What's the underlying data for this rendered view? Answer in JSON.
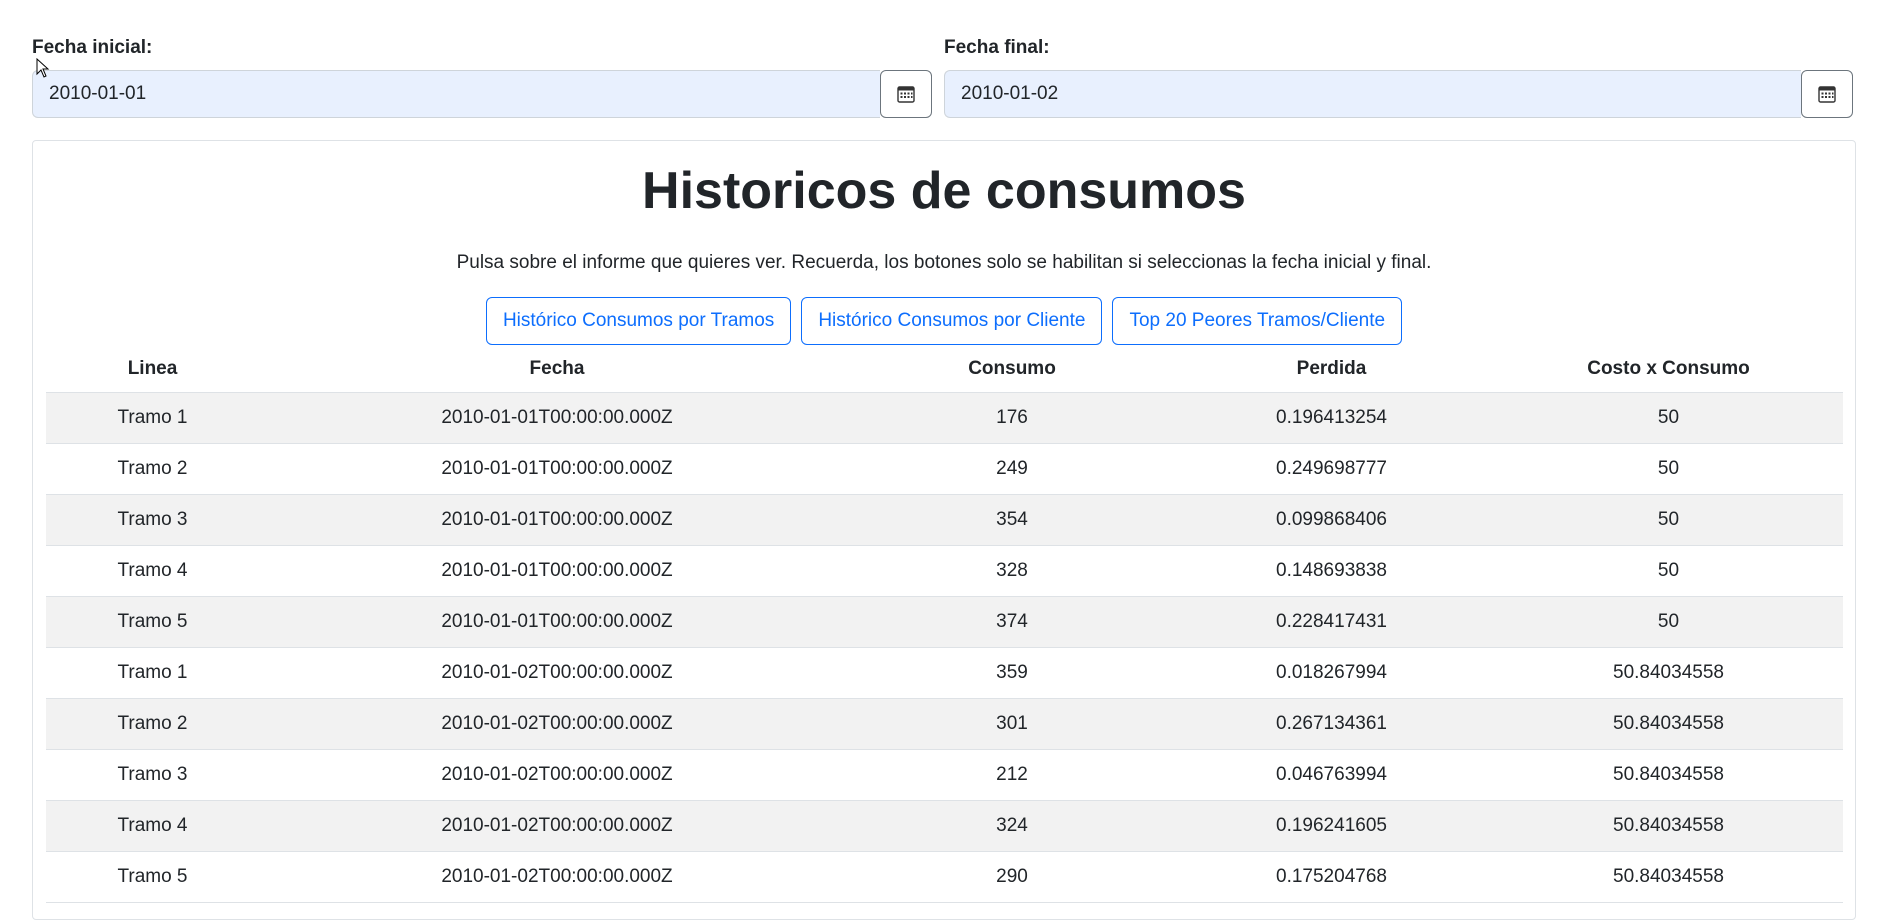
{
  "filters": {
    "start": {
      "label": "Fecha inicial:",
      "value": "2010-01-01"
    },
    "end": {
      "label": "Fecha final:",
      "value": "2010-01-02"
    }
  },
  "report": {
    "title": "Historicos de consumos",
    "subtitle": "Pulsa sobre el informe que quieres ver. Recuerda, los botones solo se habilitan si seleccionas la fecha inicial y final.",
    "buttons": {
      "tramos": "Histórico Consumos por Tramos",
      "cliente": "Histórico Consumos por Cliente",
      "top20": "Top 20 Peores Tramos/Cliente"
    }
  },
  "table": {
    "headers": [
      "Linea",
      "Fecha",
      "Consumo",
      "Perdida",
      "Costo x Consumo"
    ],
    "rows": [
      [
        "Tramo 1",
        "2010-01-01T00:00:00.000Z",
        "176",
        "0.196413254",
        "50"
      ],
      [
        "Tramo 2",
        "2010-01-01T00:00:00.000Z",
        "249",
        "0.249698777",
        "50"
      ],
      [
        "Tramo 3",
        "2010-01-01T00:00:00.000Z",
        "354",
        "0.099868406",
        "50"
      ],
      [
        "Tramo 4",
        "2010-01-01T00:00:00.000Z",
        "328",
        "0.148693838",
        "50"
      ],
      [
        "Tramo 5",
        "2010-01-01T00:00:00.000Z",
        "374",
        "0.228417431",
        "50"
      ],
      [
        "Tramo 1",
        "2010-01-02T00:00:00.000Z",
        "359",
        "0.018267994",
        "50.84034558"
      ],
      [
        "Tramo 2",
        "2010-01-02T00:00:00.000Z",
        "301",
        "0.267134361",
        "50.84034558"
      ],
      [
        "Tramo 3",
        "2010-01-02T00:00:00.000Z",
        "212",
        "0.046763994",
        "50.84034558"
      ],
      [
        "Tramo 4",
        "2010-01-02T00:00:00.000Z",
        "324",
        "0.196241605",
        "50.84034558"
      ],
      [
        "Tramo 5",
        "2010-01-02T00:00:00.000Z",
        "290",
        "0.175204768",
        "50.84034558"
      ]
    ]
  },
  "icons": {
    "calendar": "calendar-icon",
    "cursor": "mouse-pointer-icon"
  },
  "colors": {
    "primary": "#0d6efd",
    "input_bg": "#e8f0fe",
    "stripe": "#f2f2f2"
  }
}
